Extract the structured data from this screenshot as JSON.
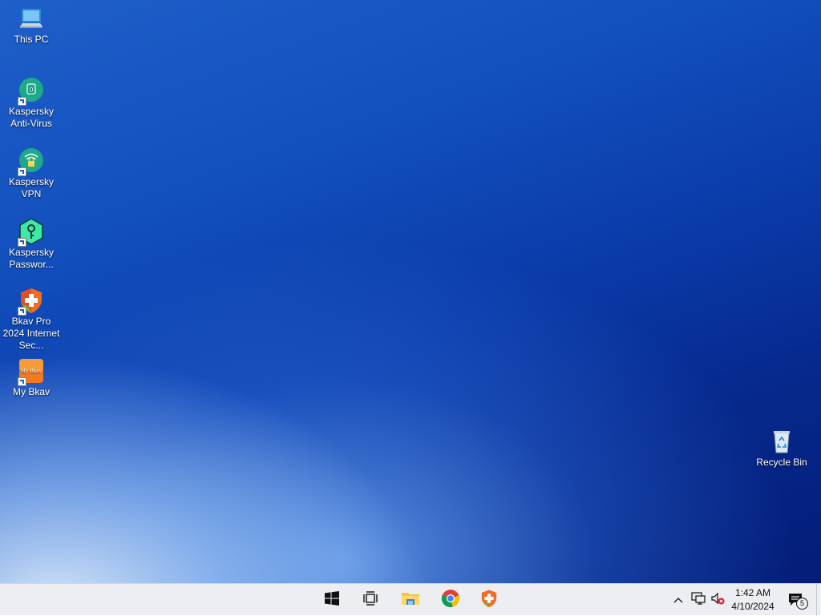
{
  "desktop": {
    "icons": [
      {
        "label": "This PC",
        "icon": "computer-icon"
      },
      {
        "label": "Kaspersky Anti-Virus",
        "icon": "kaspersky-antivirus-icon"
      },
      {
        "label": "Kaspersky VPN",
        "icon": "kaspersky-vpn-icon"
      },
      {
        "label": "Kaspersky Passwor...",
        "icon": "kaspersky-password-icon"
      },
      {
        "label": "Bkav Pro 2024 Internet Sec...",
        "icon": "bkav-shield-icon"
      },
      {
        "label": "My Bkav",
        "icon": "my-bkav-icon"
      },
      {
        "label": "Recycle Bin",
        "icon": "recycle-bin-icon"
      }
    ],
    "mybkav_icon_text": "My Bkav"
  },
  "taskbar": {
    "pinned": [
      {
        "icon": "windows-start-icon"
      },
      {
        "icon": "task-view-icon"
      },
      {
        "icon": "file-explorer-icon"
      },
      {
        "icon": "chrome-icon"
      },
      {
        "icon": "bkav-shield-icon"
      }
    ],
    "tray": {
      "chevron": "show-hidden-icons",
      "network": "network-icon",
      "volume": "volume-muted-icon"
    },
    "clock": {
      "time": "1:42 AM",
      "date": "4/10/2024"
    },
    "notifications": {
      "icon": "action-center-icon",
      "count": "5"
    }
  },
  "colors": {
    "taskbar_bg": "#eceef2",
    "desktop_dark": "#041d78",
    "desktop_light": "#cfe6ff",
    "kaspersky_green": "#1fa88a",
    "bkav_orange": "#f26b21"
  }
}
